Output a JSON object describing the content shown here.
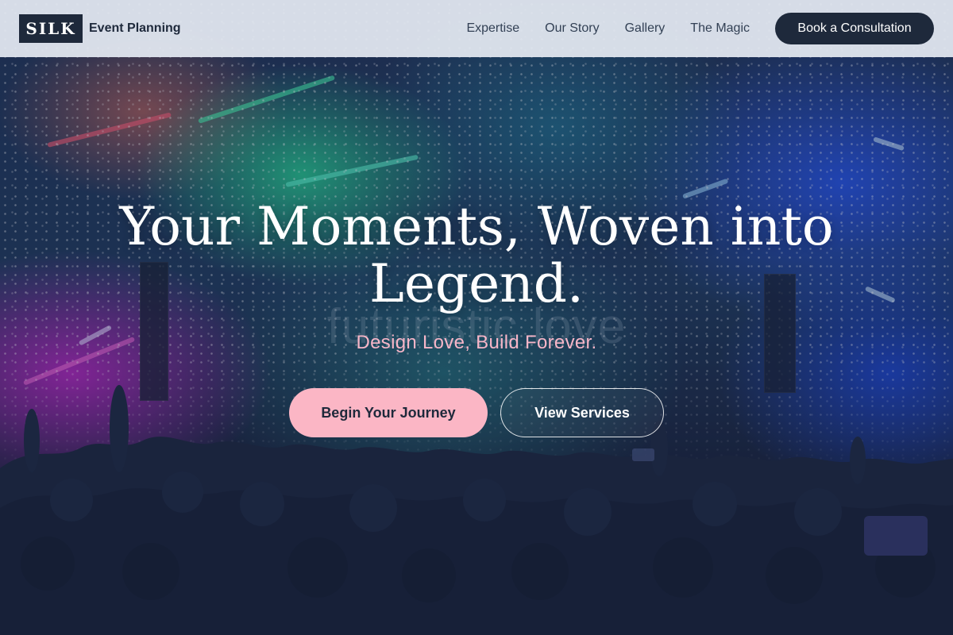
{
  "nav": {
    "logo": "SILK",
    "brand_sub": "Event Planning",
    "links": [
      {
        "label": "Expertise"
      },
      {
        "label": "Our Story"
      },
      {
        "label": "Gallery"
      },
      {
        "label": "The Magic"
      }
    ],
    "cta_label": "Book a Consultation"
  },
  "hero": {
    "title": "Your Moments, Woven into Legend.",
    "watermark": "futuristic love",
    "subtitle": "Design Love, Build Forever.",
    "primary_button": "Begin Your Journey",
    "secondary_button": "View Services",
    "background_image": "concert-crowd-photo"
  },
  "colors": {
    "navy": "#1e293b",
    "pink": "#fbb6c5",
    "nav_bg": "#e2e8f0",
    "subtitle_pink": "#f7b6c8"
  }
}
